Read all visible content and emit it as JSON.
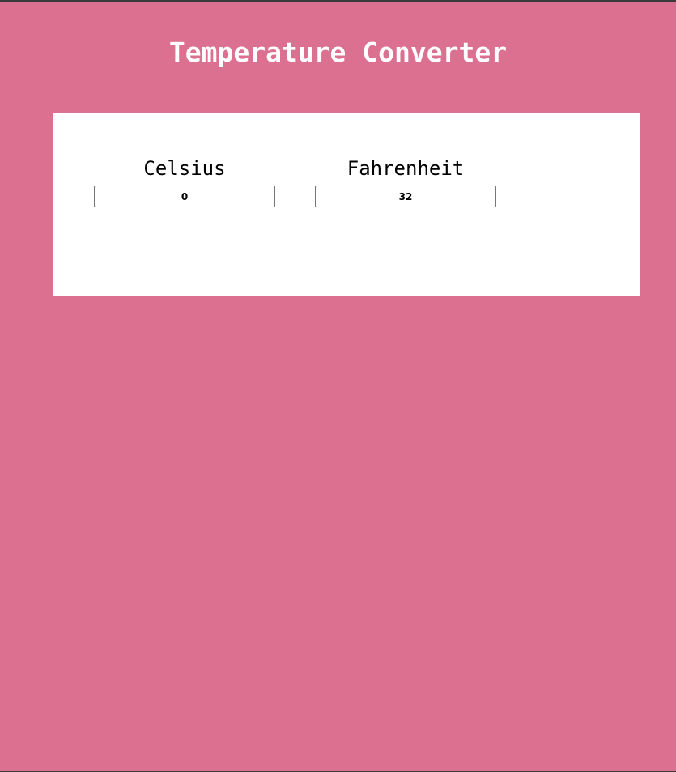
{
  "page": {
    "title": "Temperature Converter",
    "background_color": "#dc7090",
    "panel_color": "#ffffff"
  },
  "converter": {
    "celsius": {
      "label": "Celsius",
      "value": "0"
    },
    "fahrenheit": {
      "label": "Fahrenheit",
      "value": "32"
    }
  }
}
